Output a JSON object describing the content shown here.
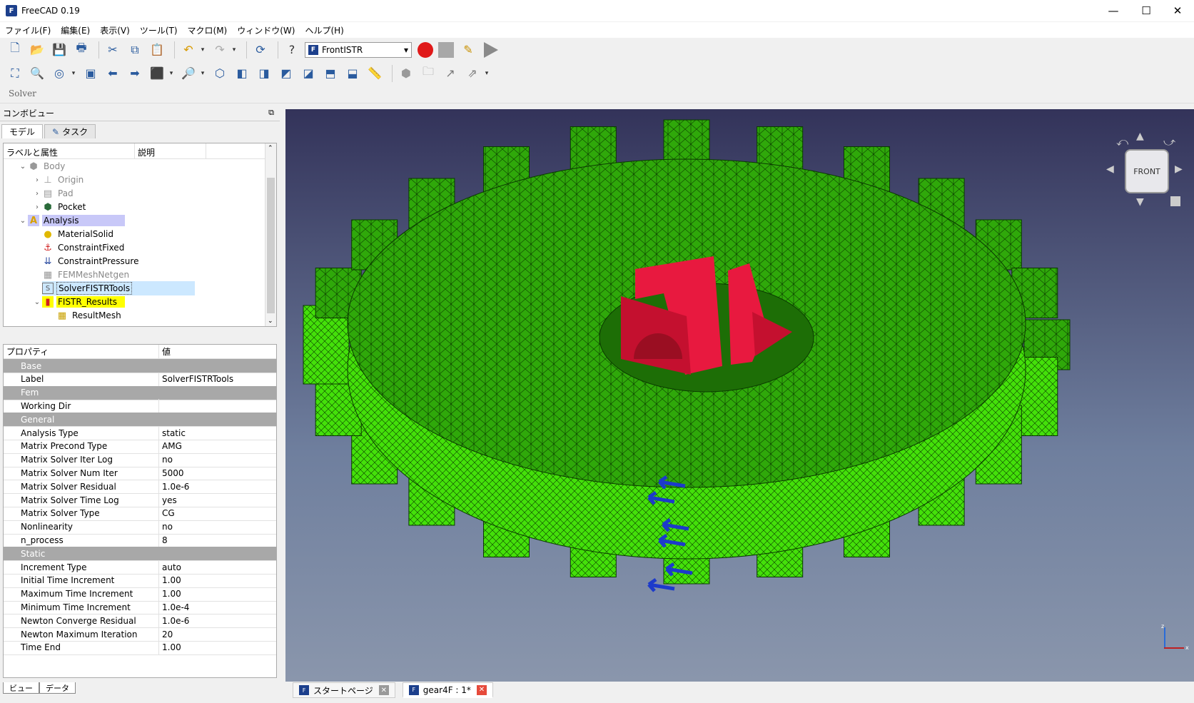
{
  "window": {
    "title": "FreeCAD 0.19",
    "minimize": "—",
    "maximize": "☐",
    "close": "✕"
  },
  "menu": [
    "ファイル(F)",
    "編集(E)",
    "表示(V)",
    "ツール(T)",
    "マクロ(M)",
    "ウィンドウ(W)",
    "ヘルプ(H)"
  ],
  "workbench": {
    "selected": "FrontISTR"
  },
  "solver_toolbar": {
    "label": "Solver"
  },
  "combo": {
    "title": "コンボビュー",
    "tabs": [
      "モデル",
      "タスク"
    ],
    "tree_headers": [
      "ラベルと属性",
      "説明"
    ],
    "tree": [
      {
        "label": "Body",
        "icon": "body-icon",
        "state": "grey"
      },
      {
        "label": "Origin",
        "icon": "origin-icon",
        "state": "grey"
      },
      {
        "label": "Pad",
        "icon": "pad-icon",
        "state": "grey"
      },
      {
        "label": "Pocket",
        "icon": "pocket-icon",
        "state": "normal"
      },
      {
        "label": "Analysis",
        "icon": "analysis-icon",
        "state": "active"
      },
      {
        "label": "MaterialSolid",
        "icon": "material-icon",
        "state": "normal"
      },
      {
        "label": "ConstraintFixed",
        "icon": "constraint-fixed-icon",
        "state": "normal"
      },
      {
        "label": "ConstraintPressure",
        "icon": "constraint-pressure-icon",
        "state": "normal"
      },
      {
        "label": "FEMMeshNetgen",
        "icon": "mesh-icon",
        "state": "grey"
      },
      {
        "label": "SolverFISTRTools",
        "icon": "solver-icon",
        "state": "selected"
      },
      {
        "label": "FISTR_Results",
        "icon": "results-icon",
        "state": "highlight"
      },
      {
        "label": "ResultMesh",
        "icon": "result-mesh-icon",
        "state": "normal"
      }
    ],
    "prop_headers": [
      "プロパティ",
      "値"
    ],
    "properties": [
      {
        "group": "Base"
      },
      {
        "key": "Label",
        "value": "SolverFISTRTools"
      },
      {
        "group": "Fem"
      },
      {
        "key": "Working Dir",
        "value": ""
      },
      {
        "group": "General"
      },
      {
        "key": "Analysis Type",
        "value": "static"
      },
      {
        "key": "Matrix Precond Type",
        "value": "AMG"
      },
      {
        "key": "Matrix Solver Iter Log",
        "value": "no"
      },
      {
        "key": "Matrix Solver Num Iter",
        "value": "5000"
      },
      {
        "key": "Matrix Solver Residual",
        "value": "1.0e-6"
      },
      {
        "key": "Matrix Solver Time Log",
        "value": "yes"
      },
      {
        "key": "Matrix Solver Type",
        "value": "CG"
      },
      {
        "key": "Nonlinearity",
        "value": "no"
      },
      {
        "key": "n_process",
        "value": "8"
      },
      {
        "group": "Static"
      },
      {
        "key": "Increment Type",
        "value": "auto"
      },
      {
        "key": "Initial Time Increment",
        "value": "1.00"
      },
      {
        "key": "Maximum Time Increment",
        "value": "1.00"
      },
      {
        "key": "Minimum Time Increment",
        "value": "1.0e-4"
      },
      {
        "key": "Newton Converge Residual",
        "value": "1.0e-6"
      },
      {
        "key": "Newton Maximum Iteration",
        "value": "20"
      },
      {
        "key": "Time End",
        "value": "1.00"
      }
    ],
    "bottom_tabs": [
      "ビュー",
      "データ"
    ]
  },
  "navcube": {
    "face": "FRONT"
  },
  "doc_tabs": [
    {
      "label": "スタートページ"
    },
    {
      "label": "gear4F : 1*"
    }
  ]
}
